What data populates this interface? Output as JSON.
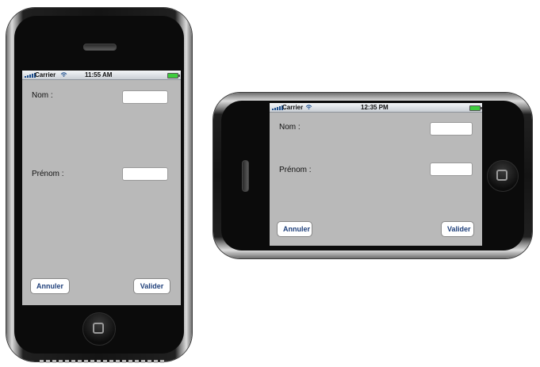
{
  "colors": {
    "screen_bg": "#b9b9b9",
    "button_text": "#1e3f7a",
    "battery": "#3dcc3d"
  },
  "portrait": {
    "statusbar": {
      "carrier": "Carrier",
      "time": "11:55 AM"
    },
    "form": {
      "nom_label": "Nom :",
      "prenom_label": "Prénom :",
      "annuler_label": "Annuler",
      "valider_label": "Valider"
    }
  },
  "landscape": {
    "statusbar": {
      "carrier": "Carrier",
      "time": "12:35 PM"
    },
    "form": {
      "nom_label": "Nom :",
      "prenom_label": "Prénom :",
      "annuler_label": "Annuler",
      "valider_label": "Valider"
    }
  },
  "icons": {
    "signal": "signal-bars-icon",
    "wifi": "wifi-icon",
    "battery": "battery-icon",
    "home": "home-button-icon",
    "speaker": "speaker-grille-icon"
  }
}
